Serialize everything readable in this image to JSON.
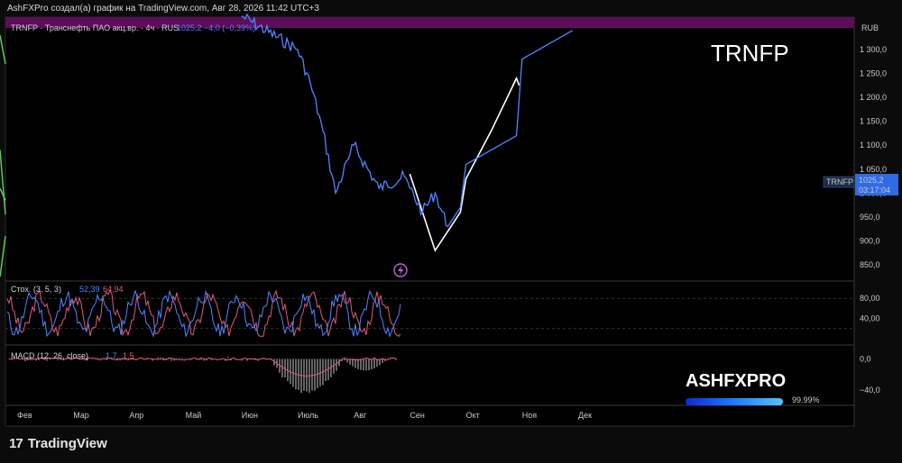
{
  "header": {
    "title": "AshFXPro создал(а) график на TradingView.com, Авг 28, 2026 11:42 UTC+3"
  },
  "symbol": {
    "description": "TRNFP · Транснефть ПАО акц.вр. · 4ч · RUS",
    "last_change": "1025,2  −4,0 (−0,39%)",
    "tag": "TRNFP",
    "tag_price": "1025,2",
    "tag_timer": "03:17:04",
    "currency": "RUB"
  },
  "overlay_ticker": "TRNFP",
  "brand": {
    "name": "ASHFXPRO",
    "percent": "99.99%"
  },
  "tradingview_label": "TradingView",
  "colors": {
    "price_line": "#4f86ff",
    "trend_line": "#5ed35e",
    "projection": "#ffffff",
    "stoch_k": "#4f86ff",
    "stoch_d": "#e05a7a",
    "top_band": "#5d0d5a"
  },
  "chart_data": [
    {
      "type": "line",
      "title": "TRNFP · Транснефть ПАО акц.вр. · 4ч · RUS",
      "ylim": [
        820,
        1380
      ],
      "x_axis_ticks": [
        "Фев",
        "Мар",
        "Апр",
        "Май",
        "Июн",
        "Июль",
        "Авг",
        "Сен",
        "Окт",
        "Ноя",
        "Дек"
      ],
      "y_axis_ticks": [
        850,
        900,
        950,
        1000,
        1050,
        1100,
        1150,
        1200,
        1250,
        1300
      ],
      "y_tick_labels": [
        "850,0",
        "900,0",
        "950,0",
        "1 000,0",
        "1 050,0",
        "1 100,0",
        "1 150,0",
        "1 200,0",
        "1 250,0",
        "1 300,0"
      ],
      "last_value": 1025.2,
      "series": [
        {
          "name": "TRNFP",
          "points": [
            [
              "Июн",
              1370
            ],
            [
              "Июль",
              1300
            ],
            [
              "Июль",
              1230
            ],
            [
              "Июль",
              1130
            ],
            [
              "Июль",
              1000
            ],
            [
              "Июль",
              1070
            ],
            [
              "Авг",
              1100
            ],
            [
              "Авг",
              1010
            ],
            [
              "Авг",
              1035
            ],
            [
              "Сен",
              1010
            ],
            [
              "Сен",
              960
            ],
            [
              "Сен",
              1000
            ],
            [
              "Сен",
              930
            ],
            [
              "Сен",
              970
            ],
            [
              "Окт",
              1060
            ],
            [
              "Окт",
              1120
            ],
            [
              "Ноя",
              1280
            ],
            [
              "Ноя",
              1340
            ]
          ]
        },
        {
          "points": [
            [
              "Сен",
              1040
            ],
            [
              "Сен",
              880
            ],
            [
              "Сен",
              960
            ],
            [
              "Окт",
              1030
            ],
            [
              "Окт",
              1130
            ],
            [
              "Окт",
              1240
            ]
          ]
        }
      ],
      "trend_lines": [
        {
          "from": [
            "Фев",
            1270
          ],
          "to": [
            "Дек+",
            1330
          ]
        },
        {
          "from": [
            "Фев",
            955
          ],
          "to": [
            "Дек+",
            1090
          ]
        },
        {
          "from": [
            "Фев",
            985
          ],
          "to": [
            "Дек+",
            1010
          ]
        },
        {
          "from": [
            "Фев",
            910
          ],
          "to": [
            "Дек",
            825
          ]
        }
      ]
    },
    {
      "type": "line",
      "title": "Стох. (3, 5, 3)",
      "ylim": [
        0,
        100
      ],
      "y_axis_ticks": [
        40,
        80
      ],
      "y_tick_labels": [
        "40,00",
        "80,00"
      ],
      "series": [
        {
          "name": "%K",
          "value_label": "52,39"
        },
        {
          "name": "%D",
          "value_label": "64,94"
        }
      ],
      "reference_lines": [
        20,
        80
      ]
    },
    {
      "type": "bar",
      "title": "MACD (12, 26, close)",
      "ylim": [
        -55,
        12
      ],
      "y_axis_ticks": [
        0,
        -40
      ],
      "y_tick_labels": [
        "0,0",
        "−40,0"
      ],
      "value_labels": [
        "1,7",
        "1,5"
      ]
    }
  ]
}
